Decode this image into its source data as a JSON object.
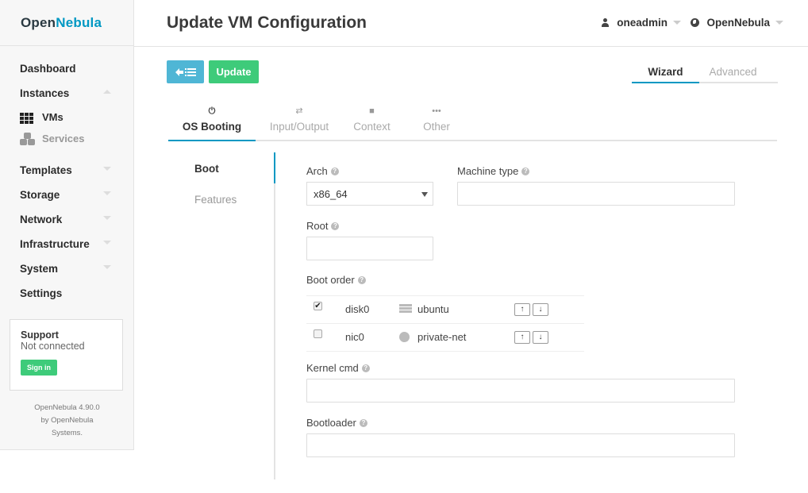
{
  "app": {
    "logo_prefix": "Open",
    "logo_suffix": "Nebula"
  },
  "sidebar": {
    "items": [
      {
        "label": "Dashboard"
      },
      {
        "label": "Instances"
      },
      {
        "label": "Templates"
      },
      {
        "label": "Storage"
      },
      {
        "label": "Network"
      },
      {
        "label": "Infrastructure"
      },
      {
        "label": "System"
      },
      {
        "label": "Settings"
      }
    ],
    "instances_sub": [
      {
        "label": "VMs",
        "icon": "grid-icon"
      },
      {
        "label": "Services",
        "icon": "cubes-icon"
      }
    ],
    "support": {
      "title": "Support",
      "status": "Not connected",
      "signin_label": "Sign in"
    },
    "version_line1": "OpenNebula 4.90.0",
    "version_line2": "by OpenNebula",
    "version_line3": "Systems."
  },
  "header": {
    "title": "Update VM Configuration",
    "user": "oneadmin",
    "zone": "OpenNebula"
  },
  "toolbar": {
    "back_icon": "arrow-left-list-icon",
    "update_label": "Update"
  },
  "mode_tabs": [
    {
      "label": "Wizard",
      "active": true
    },
    {
      "label": "Advanced",
      "active": false
    }
  ],
  "section_tabs": [
    {
      "label": "OS Booting",
      "icon": "power-icon",
      "active": true
    },
    {
      "label": "Input/Output",
      "icon": "exchange-icon",
      "active": false
    },
    {
      "label": "Context",
      "icon": "folder-icon",
      "active": false
    },
    {
      "label": "Other",
      "icon": "ellipsis-icon",
      "active": false
    }
  ],
  "vtabs": [
    {
      "label": "Boot",
      "active": true
    },
    {
      "label": "Features",
      "active": false
    }
  ],
  "form": {
    "arch_label": "Arch",
    "arch_value": "x86_64",
    "machine_type_label": "Machine type",
    "machine_type_value": "",
    "root_label": "Root",
    "root_value": "",
    "boot_order_label": "Boot order",
    "boot_order": [
      {
        "checked": true,
        "device": "disk0",
        "icon": "disk-icon",
        "target": "ubuntu"
      },
      {
        "checked": false,
        "device": "nic0",
        "icon": "globe-icon",
        "target": "private-net"
      }
    ],
    "kernel_cmd_label": "Kernel cmd",
    "kernel_cmd_value": "",
    "bootloader_label": "Bootloader",
    "bootloader_value": ""
  },
  "colors": {
    "brand": "#0098c3",
    "info_button": "#4fb6d5",
    "success_button": "#3ecb7a"
  }
}
